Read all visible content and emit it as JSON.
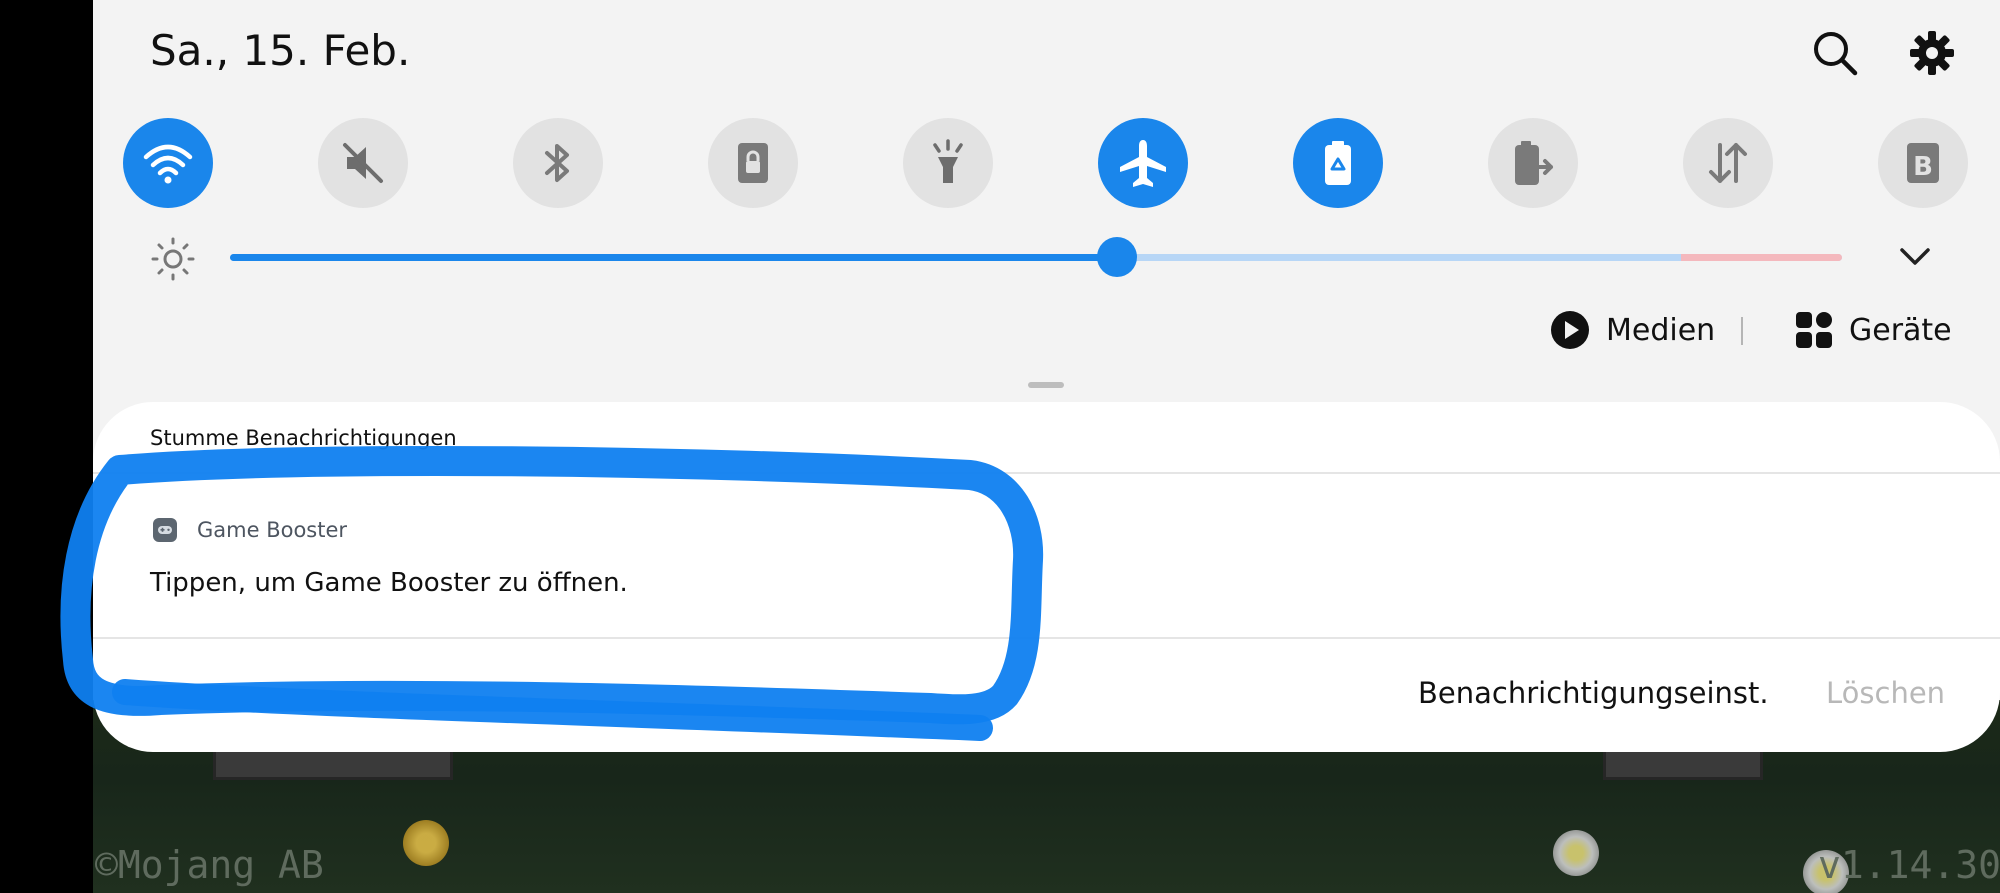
{
  "status": {
    "date": "Sa., 15. Feb."
  },
  "header_icons": {
    "search": "search-icon",
    "settings": "gear-icon"
  },
  "quick_tiles": [
    {
      "name": "wifi",
      "icon": "wifi-icon",
      "active": true
    },
    {
      "name": "mute",
      "icon": "mute-icon",
      "active": false
    },
    {
      "name": "bluetooth",
      "icon": "bluetooth-icon",
      "active": false
    },
    {
      "name": "lock",
      "icon": "lock-icon",
      "active": false
    },
    {
      "name": "flashlight",
      "icon": "flashlight-icon",
      "active": false
    },
    {
      "name": "airplane",
      "icon": "airplane-icon",
      "active": true
    },
    {
      "name": "power-saving",
      "icon": "battery-recycle-icon",
      "active": true
    },
    {
      "name": "wireless-powershare",
      "icon": "battery-share-icon",
      "active": false
    },
    {
      "name": "mobile-data",
      "icon": "data-arrows-icon",
      "active": false
    },
    {
      "name": "bixby",
      "icon": "b-icon",
      "active": false
    }
  ],
  "brightness": {
    "level": 0.55,
    "red_zone_start": 0.9
  },
  "media_controls": {
    "media_label": "Medien",
    "devices_label": "Geräte"
  },
  "notifications": {
    "section_title": "Stumme Benachrichtigungen",
    "items": [
      {
        "app_name": "Game Booster",
        "text": "Tippen, um Game Booster zu öffnen."
      }
    ],
    "settings_label": "Benachrichtigungseinst.",
    "clear_label": "Löschen"
  },
  "background": {
    "copyright": "©Mojang AB",
    "version": "v1.14.30"
  },
  "colors": {
    "accent": "#1a86eb",
    "tile_off": "#e2e2e2",
    "annotation": "#0f7ff0"
  }
}
